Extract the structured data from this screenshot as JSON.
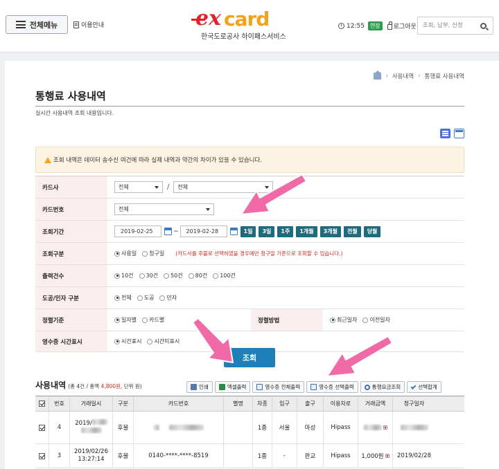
{
  "header": {
    "menu_label": "전체메뉴",
    "guide_label": "이용안내",
    "logo_ex": "ex",
    "logo_card": "card",
    "logo_sub": "한국도로공사 하이패스서비스",
    "time": "12:55",
    "extend_label": "연장",
    "logout_label": "로그아웃",
    "search_placeholder": "조회, 납부, 신청"
  },
  "breadcrumb": [
    "사용내역",
    "통행료 사용내역"
  ],
  "page": {
    "title": "통행료 사용내역",
    "description": "실시간 사용내역 조회 내용입니다."
  },
  "notice": "조회 내역은 데이터 송수신 여건에 따라 실제 내역과 약간의 차이가 있을 수 있습니다.",
  "form": {
    "card_company": {
      "label": "카드사",
      "select1": "전체",
      "select2": "전체"
    },
    "card_number": {
      "label": "카드번호",
      "select": "전체"
    },
    "period": {
      "label": "조회기간",
      "from": "2019-02-25",
      "to": "2019-02-28",
      "buttons": [
        "1일",
        "3일",
        "1주",
        "1개월",
        "3개월",
        "전월",
        "당월"
      ]
    },
    "query_type": {
      "label": "조회구분",
      "options": [
        "사용일",
        "청구일"
      ],
      "selected": 0,
      "note": "(카드사를 후불로 선택하였을 경우에만 청구일 기준으로 조회할 수 있습니다.)"
    },
    "output_count": {
      "label": "출력건수",
      "options": [
        "10건",
        "30건",
        "50건",
        "80건",
        "100건"
      ],
      "selected": 0
    },
    "road_type": {
      "label": "도공/민자 구분",
      "options": [
        "전체",
        "도공",
        "민자"
      ],
      "selected": 0
    },
    "sort_basis": {
      "label": "정렬기준",
      "options": [
        "일자별",
        "카드별"
      ],
      "selected": 0
    },
    "sort_method": {
      "label": "정렬방법",
      "options": [
        "최근일자",
        "이전일자"
      ],
      "selected": 0
    },
    "receipt_time": {
      "label": "영수증 시간표시",
      "options": [
        "시간표시",
        "시간미표시"
      ],
      "selected": 0
    },
    "submit_label": "조회"
  },
  "usage": {
    "title": "사용내역",
    "summary_prefix": "(총 4건 / 총액 ",
    "summary_amount": "4,800원",
    "summary_suffix": ", 단위 원)",
    "toolbar": [
      "인쇄",
      "엑셀출력",
      "영수증 전체출력",
      "영수증 선택출력",
      "통행요금조회",
      "선택합계"
    ]
  },
  "table": {
    "headers": [
      "",
      "번호",
      "거래일시",
      "구분",
      "카드번호",
      "별명",
      "차종",
      "입구",
      "출구",
      "이용차로",
      "거래금액",
      "청구일자"
    ],
    "rows": [
      {
        "checked": true,
        "no": "4",
        "date1": "2019/",
        "date2": "",
        "type": "후불",
        "card": "",
        "alias": "",
        "car": "1종",
        "entry": "서울",
        "exit": "마성",
        "lane": "Hipass",
        "amount": "",
        "billing": ""
      },
      {
        "checked": true,
        "no": "3",
        "date1": "2019/02/26",
        "date2": "13:27:14",
        "type": "후불",
        "card": "0140-****-****-8519",
        "alias": "",
        "car": "1종",
        "entry": "-",
        "exit": "판교",
        "lane": "Hipass",
        "amount": "1,000원",
        "billing": "2019/02/28"
      }
    ]
  },
  "colors": {
    "brand_red": "#e2232a",
    "brand_orange": "#f4a21c",
    "button_teal": "#1f6b7e",
    "search_blue": "#1f7fb8",
    "arrow_pink": "#f06aa8"
  }
}
